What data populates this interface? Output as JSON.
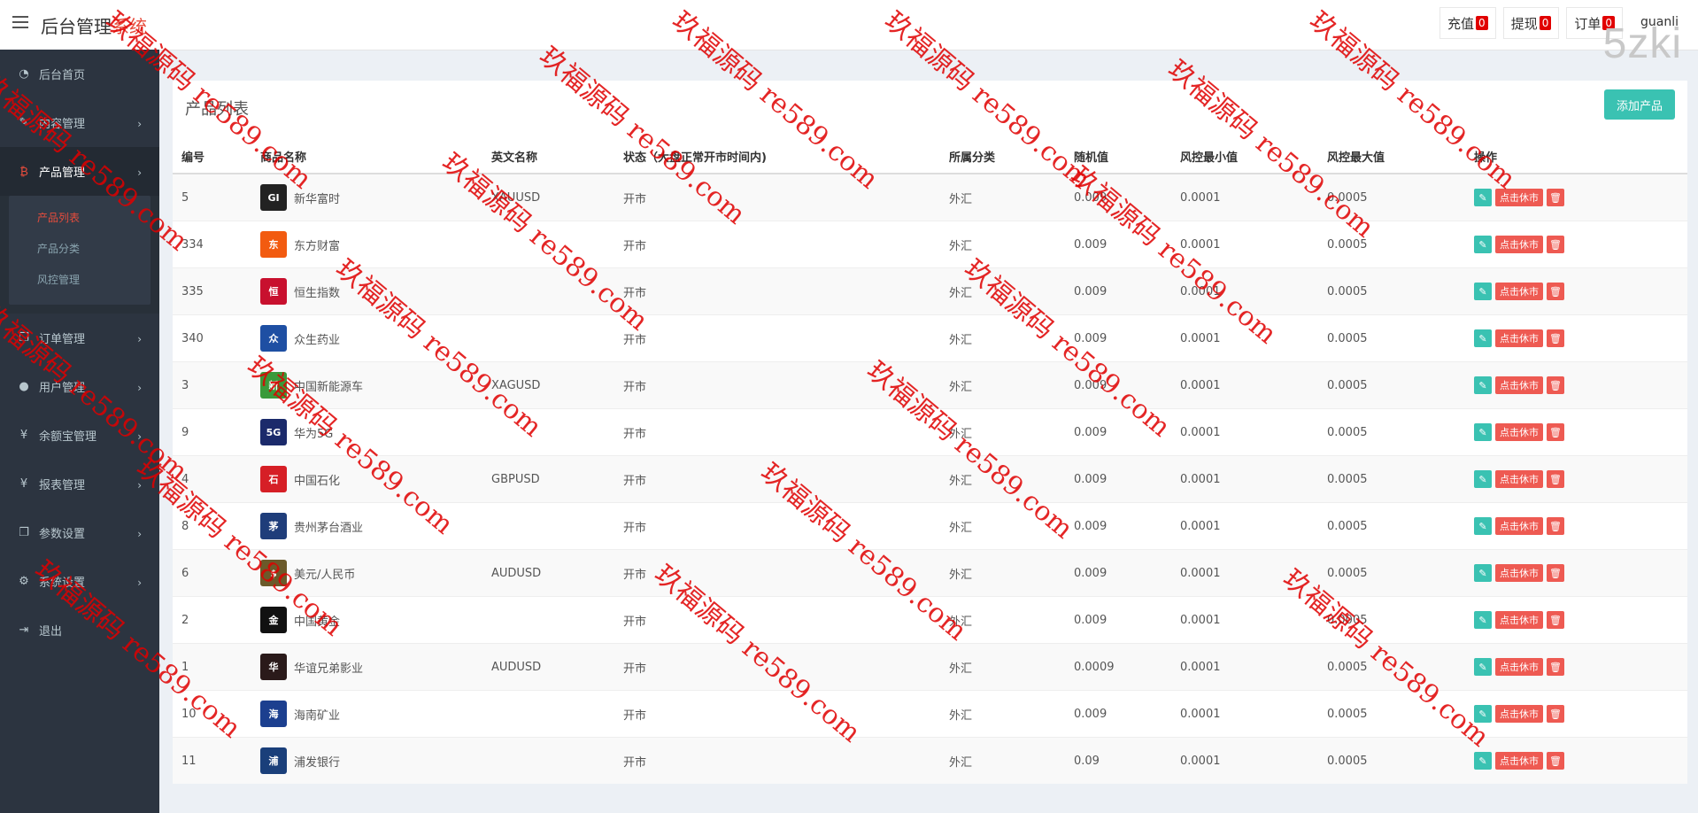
{
  "header": {
    "brand_main": "后台管理",
    "brand_accent": "系统",
    "actions": [
      {
        "label": "充值",
        "count": "0"
      },
      {
        "label": "提现",
        "count": "0"
      },
      {
        "label": "订单",
        "count": "0"
      }
    ],
    "user": "guanli",
    "logo_text": "5zki"
  },
  "sidebar": {
    "items": [
      {
        "label": "后台首页",
        "icon": "dashboard-icon"
      },
      {
        "label": "内容管理",
        "icon": "edit-icon"
      },
      {
        "label": "产品管理",
        "icon": "bitcoin-icon"
      },
      {
        "label": "订单管理",
        "icon": "copy-icon"
      },
      {
        "label": "用户管理",
        "icon": "user-icon"
      },
      {
        "label": "余额宝管理",
        "icon": "yen-icon"
      },
      {
        "label": "报表管理",
        "icon": "yen-icon"
      },
      {
        "label": "参数设置",
        "icon": "copy-icon"
      },
      {
        "label": "系统设置",
        "icon": "gears-icon"
      },
      {
        "label": "退出",
        "icon": "sign-out-icon"
      }
    ],
    "sub_items": [
      "产品列表",
      "产品分类",
      "风控管理"
    ]
  },
  "panel": {
    "title": "产品列表",
    "add_button": "添加产品",
    "columns": [
      "编号",
      "商品名称",
      "英文名称",
      "状态（大盘正常开市时间内)",
      "所属分类",
      "随机值",
      "风控最小值",
      "风控最大值",
      "操作"
    ],
    "rows": [
      {
        "id": "5",
        "name": "新华富时",
        "en": "XAUUSD",
        "status": "开市",
        "category": "外汇",
        "random": "0.009",
        "min": "0.0001",
        "max": "0.0005",
        "logo_color": "#222222",
        "logo_text": "GI"
      },
      {
        "id": "334",
        "name": "东方财富",
        "en": "",
        "status": "开市",
        "category": "外汇",
        "random": "0.009",
        "min": "0.0001",
        "max": "0.0005",
        "logo_color": "#f25b10",
        "logo_text": "东"
      },
      {
        "id": "335",
        "name": "恒生指数",
        "en": "",
        "status": "开市",
        "category": "外汇",
        "random": "0.009",
        "min": "0.0001",
        "max": "0.0005",
        "logo_color": "#c8102e",
        "logo_text": "恒"
      },
      {
        "id": "340",
        "name": "众生药业",
        "en": "",
        "status": "开市",
        "category": "外汇",
        "random": "0.009",
        "min": "0.0001",
        "max": "0.0005",
        "logo_color": "#1e4fa3",
        "logo_text": "众"
      },
      {
        "id": "3",
        "name": "中国新能源车",
        "en": "XAGUSD",
        "status": "开市",
        "category": "外汇",
        "random": "0.009",
        "min": "0.0001",
        "max": "0.0005",
        "logo_color": "#3a9a3a",
        "logo_text": "新"
      },
      {
        "id": "9",
        "name": "华为5G",
        "en": "",
        "status": "开市",
        "category": "外汇",
        "random": "0.009",
        "min": "0.0001",
        "max": "0.0005",
        "logo_color": "#1b2a6b",
        "logo_text": "5G"
      },
      {
        "id": "4",
        "name": "中国石化",
        "en": "GBPUSD",
        "status": "开市",
        "category": "外汇",
        "random": "0.009",
        "min": "0.0001",
        "max": "0.0005",
        "logo_color": "#d61f26",
        "logo_text": "石"
      },
      {
        "id": "8",
        "name": "贵州茅台酒业",
        "en": "",
        "status": "开市",
        "category": "外汇",
        "random": "0.009",
        "min": "0.0001",
        "max": "0.0005",
        "logo_color": "#1f3d7a",
        "logo_text": "茅"
      },
      {
        "id": "6",
        "name": "美元/人民币",
        "en": "AUDUSD",
        "status": "开市",
        "category": "外汇",
        "random": "0.009",
        "min": "0.0001",
        "max": "0.0005",
        "logo_color": "#6b5a2a",
        "logo_text": "$"
      },
      {
        "id": "2",
        "name": "中国黄金",
        "en": "",
        "status": "开市",
        "category": "外汇",
        "random": "0.009",
        "min": "0.0001",
        "max": "0.0005",
        "logo_color": "#111111",
        "logo_text": "金"
      },
      {
        "id": "1",
        "name": "华谊兄弟影业",
        "en": "AUDUSD",
        "status": "开市",
        "category": "外汇",
        "random": "0.0009",
        "min": "0.0001",
        "max": "0.0005",
        "logo_color": "#2a1a1a",
        "logo_text": "华"
      },
      {
        "id": "10",
        "name": "海南矿业",
        "en": "",
        "status": "开市",
        "category": "外汇",
        "random": "0.009",
        "min": "0.0001",
        "max": "0.0005",
        "logo_color": "#1c3f8f",
        "logo_text": "海"
      },
      {
        "id": "11",
        "name": "浦发银行",
        "en": "",
        "status": "开市",
        "category": "外汇",
        "random": "0.09",
        "min": "0.0001",
        "max": "0.0005",
        "logo_color": "#1a3f7a",
        "logo_text": "浦"
      }
    ],
    "op_toggle_label": "点击休市"
  },
  "watermarks": {
    "text": "玖福源码 re589.com"
  }
}
